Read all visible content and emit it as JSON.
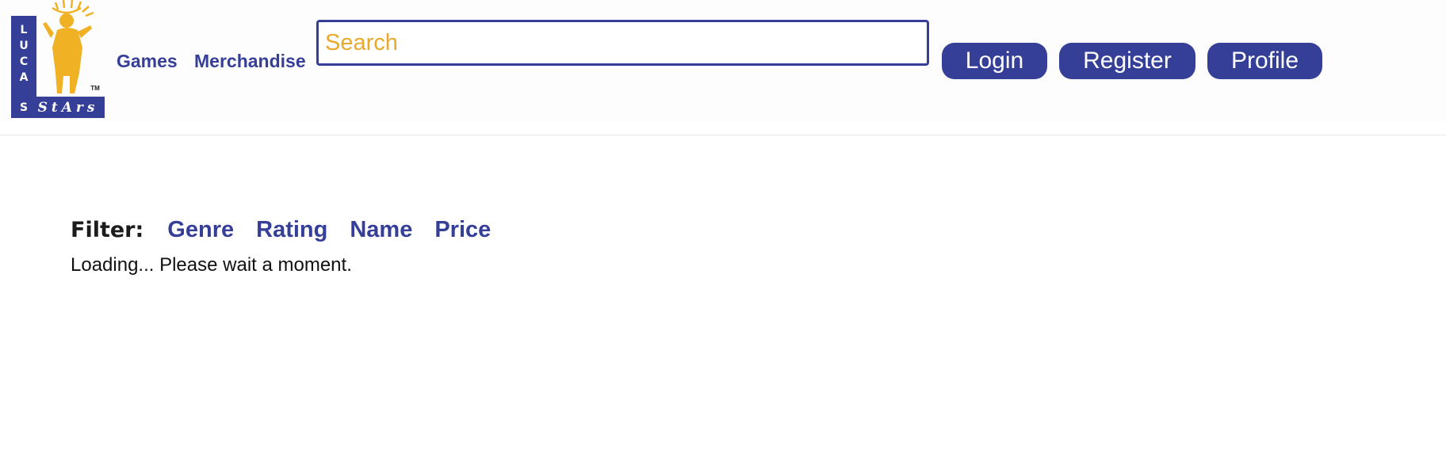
{
  "header": {
    "logo": {
      "vertical_letters": [
        "L",
        "U",
        "C",
        "A",
        "S"
      ],
      "word_mark": "StArs",
      "trademark": "TM",
      "colors": {
        "bar": "#353f97",
        "figure": "#f0b224"
      }
    },
    "nav": {
      "games": "Games",
      "merchandise": "Merchandise"
    },
    "search": {
      "placeholder": "Search",
      "value": ""
    },
    "buttons": {
      "login": "Login",
      "register": "Register",
      "profile": "Profile"
    }
  },
  "filter": {
    "label": "Filter:",
    "options": [
      "Genre",
      "Rating",
      "Name",
      "Price"
    ]
  },
  "status": {
    "loading_text": "Loading... Please wait a moment."
  },
  "theme": {
    "accent": "#353f97",
    "search_text": "#e9a92a",
    "background": "#ffffff"
  }
}
